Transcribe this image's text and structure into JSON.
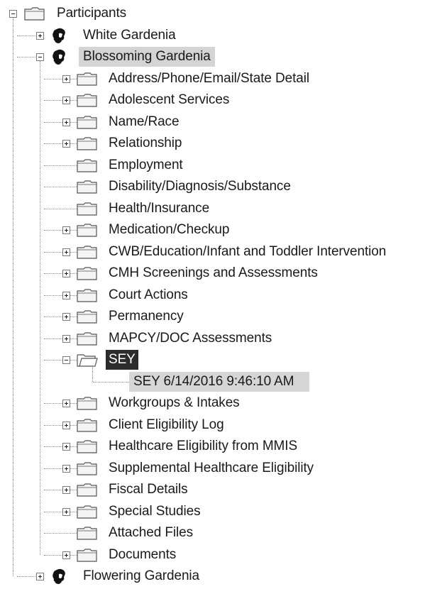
{
  "root": {
    "label": "Participants",
    "icon": "folder-icon",
    "expanded": true
  },
  "participants": [
    {
      "label": "White Gardenia",
      "icon": "person-icon",
      "expanded": false
    },
    {
      "label": "Blossoming Gardenia",
      "icon": "person-icon",
      "expanded": true,
      "selected": true
    },
    {
      "label": "Flowering Gardenia",
      "icon": "person-icon",
      "expanded": false
    }
  ],
  "sections": [
    {
      "label": "Address/Phone/Email/State Detail",
      "icon": "folder-icon",
      "has_children": true
    },
    {
      "label": "Adolescent Services",
      "icon": "folder-icon",
      "has_children": true
    },
    {
      "label": "Name/Race",
      "icon": "folder-icon",
      "has_children": true
    },
    {
      "label": "Relationship",
      "icon": "folder-icon",
      "has_children": true
    },
    {
      "label": "Employment",
      "icon": "folder-icon",
      "has_children": false
    },
    {
      "label": "Disability/Diagnosis/Substance",
      "icon": "folder-icon",
      "has_children": false
    },
    {
      "label": "Health/Insurance",
      "icon": "folder-icon",
      "has_children": false
    },
    {
      "label": "Medication/Checkup",
      "icon": "folder-icon",
      "has_children": true
    },
    {
      "label": "CWB/Education/Infant and Toddler Intervention",
      "icon": "folder-icon",
      "has_children": true
    },
    {
      "label": "CMH Screenings and Assessments",
      "icon": "folder-icon",
      "has_children": true
    },
    {
      "label": "Court Actions",
      "icon": "folder-icon",
      "has_children": true
    },
    {
      "label": "Permanency",
      "icon": "folder-icon",
      "has_children": true
    },
    {
      "label": "MAPCY/DOC Assessments",
      "icon": "folder-icon",
      "has_children": true
    },
    {
      "label": "SEY",
      "icon": "open-folder-icon",
      "has_children": true,
      "expanded": true,
      "highlighted": true
    },
    {
      "label": "Workgroups & Intakes",
      "icon": "folder-icon",
      "has_children": true
    },
    {
      "label": "Client Eligibility Log",
      "icon": "folder-icon",
      "has_children": true
    },
    {
      "label": "Healthcare Eligibility from MMIS",
      "icon": "folder-icon",
      "has_children": true
    },
    {
      "label": "Supplemental Healthcare Eligibility",
      "icon": "folder-icon",
      "has_children": true
    },
    {
      "label": "Fiscal Details",
      "icon": "folder-icon",
      "has_children": true
    },
    {
      "label": "Special Studies",
      "icon": "folder-icon",
      "has_children": true
    },
    {
      "label": "Attached Files",
      "icon": "folder-icon",
      "has_children": false
    },
    {
      "label": "Documents",
      "icon": "folder-icon",
      "has_children": true
    }
  ],
  "sey_children": [
    {
      "label": "SEY 6/14/2016 9:46:10 AM",
      "selected": true
    }
  ],
  "colors": {
    "selection_dark": "#2c2c2c",
    "selection_light": "#d6d6d6",
    "tree_lines": "#8a8a8a"
  }
}
